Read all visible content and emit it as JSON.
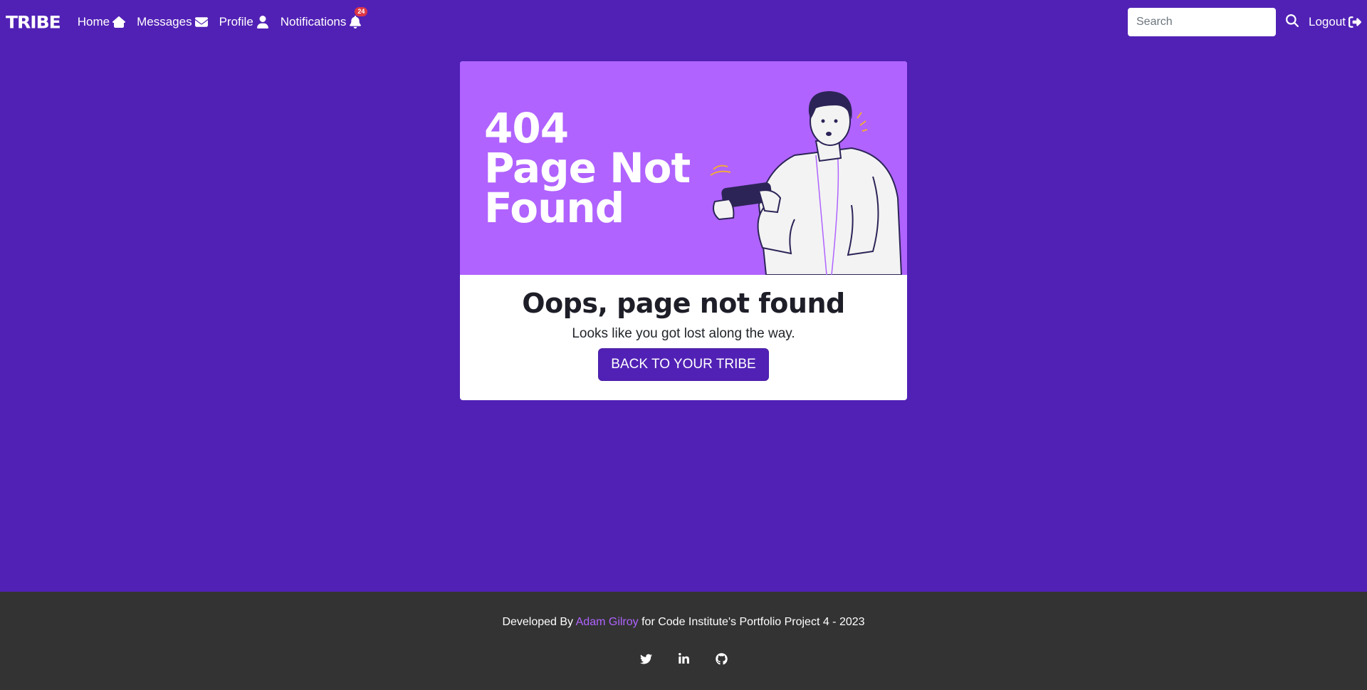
{
  "nav": {
    "brand": "TRIBE",
    "items": [
      {
        "label": "Home",
        "icon": "home-icon"
      },
      {
        "label": "Messages",
        "icon": "envelope-icon"
      },
      {
        "label": "Profile",
        "icon": "user-icon"
      },
      {
        "label": "Notifications",
        "icon": "bell-icon",
        "badge": "24"
      }
    ],
    "search_placeholder": "Search",
    "logout_label": "Logout"
  },
  "card": {
    "hero_line1": "404",
    "hero_line2": "Page Not",
    "hero_line3": "Found",
    "title": "Oops, page not found",
    "subtitle": "Looks like you got lost along the way.",
    "button_label": "BACK TO YOUR TRIBE"
  },
  "footer": {
    "prefix": "Developed By ",
    "author": "Adam Gilroy",
    "suffix": " for Code Institute's Portfolio Project 4 - 2023",
    "social": [
      "twitter-icon",
      "linkedin-icon",
      "github-icon"
    ]
  },
  "colors": {
    "background": "#5121b5",
    "hero": "#b063ff",
    "footer": "#333333",
    "badge": "#dc3545"
  }
}
